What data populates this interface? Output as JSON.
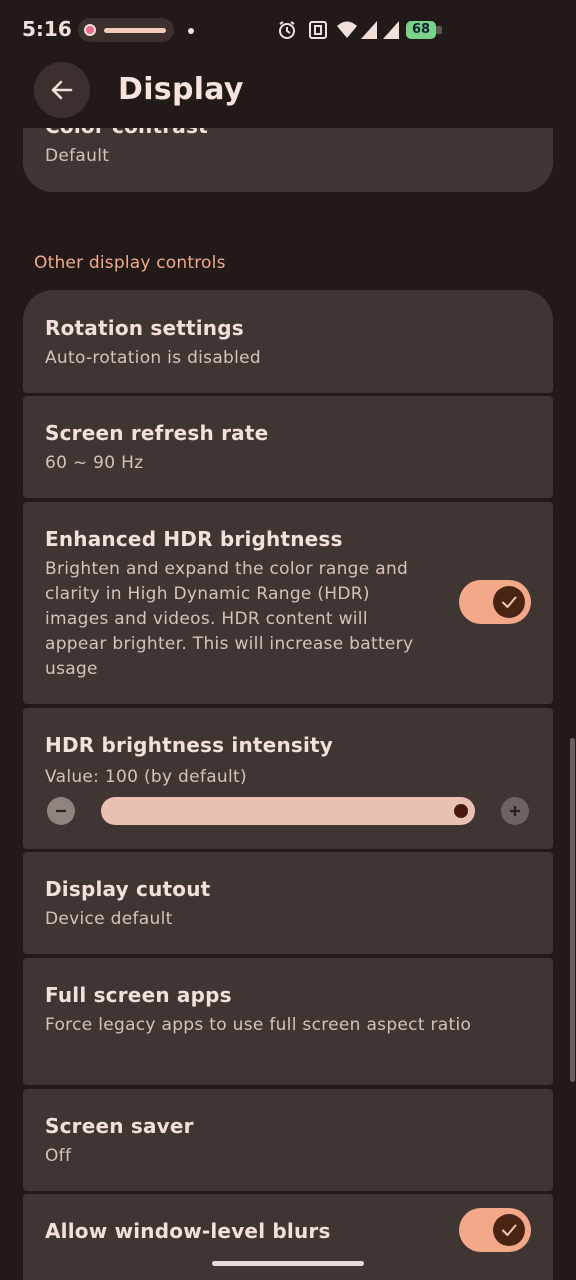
{
  "status_bar": {
    "time": "5:16",
    "battery": "68",
    "icons": [
      "notification-pill-icon",
      "alarm-icon",
      "nfc-icon",
      "wifi-icon",
      "signal-icon",
      "signal-icon",
      "battery-charging-icon"
    ]
  },
  "app_bar": {
    "title": "Display"
  },
  "items": {
    "color_contrast": {
      "title": "Color contrast",
      "subtitle": "Default"
    },
    "section": "Other display controls",
    "rotation": {
      "title": "Rotation settings",
      "subtitle": "Auto-rotation is disabled"
    },
    "refresh": {
      "title": "Screen refresh rate",
      "subtitle": "60 ~ 90 Hz"
    },
    "hdr": {
      "title": "Enhanced HDR brightness",
      "subtitle": "Brighten and expand the color range and clarity in High Dynamic Range (HDR) images and videos. HDR content will appear brighter. This will increase battery usage",
      "toggle": "on"
    },
    "hdr_intensity": {
      "title": "HDR brightness intensity",
      "subtitle": "Value: 100 (by default)",
      "value_fraction": 1.0
    },
    "cutout": {
      "title": "Display cutout",
      "subtitle": "Device default"
    },
    "fullscreen": {
      "title": "Full screen apps",
      "subtitle": "Force legacy apps to use full screen aspect ratio"
    },
    "screensaver": {
      "title": "Screen saver",
      "subtitle": "Off"
    },
    "blurs": {
      "title": "Allow window-level blurs",
      "toggle": "on"
    }
  },
  "colors": {
    "background": "#221a18",
    "card": "#3f3532",
    "accent": "#f3a88a",
    "section_label": "#f4a98a"
  }
}
